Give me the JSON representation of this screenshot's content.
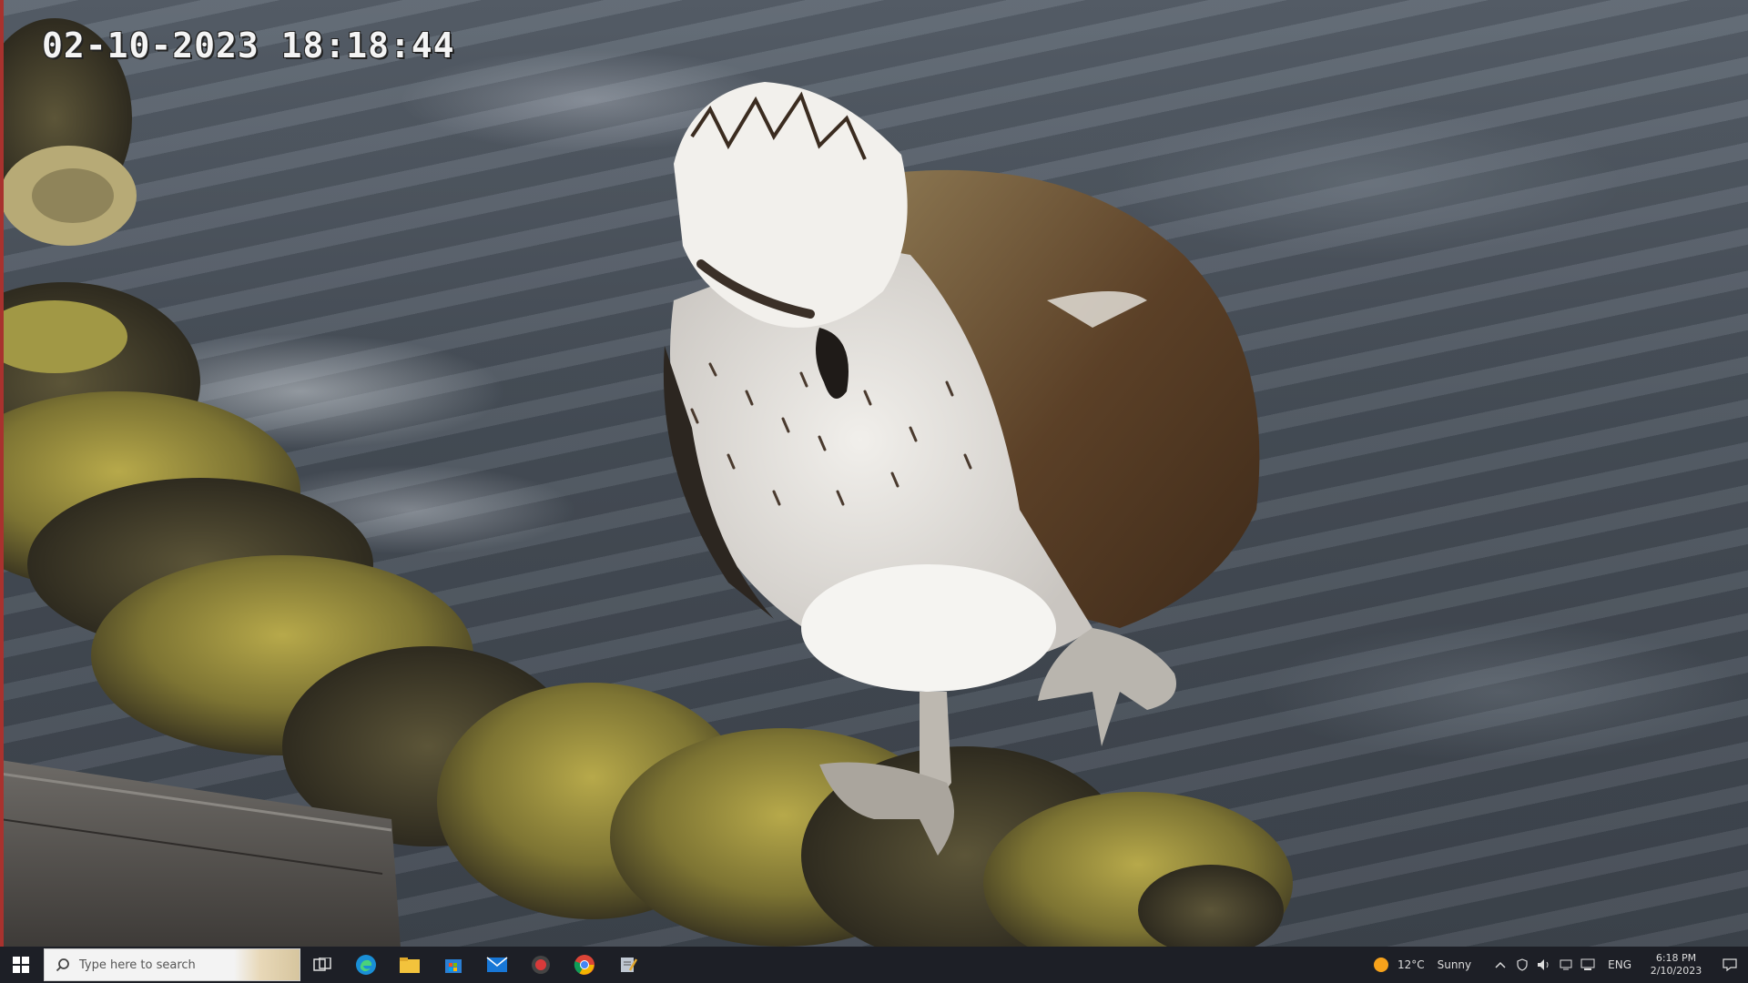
{
  "camera": {
    "timestamp": "02-10-2023 18:18:44"
  },
  "taskbar": {
    "search_placeholder": "Type here to search",
    "pinned_apps": [
      "task-view-icon",
      "edge-icon",
      "file-explorer-icon",
      "microsoft-store-icon",
      "mail-icon",
      "recorder-icon",
      "chrome-icon",
      "notepad-icon"
    ],
    "weather_temp": "12°C",
    "weather_desc": "Sunny",
    "language": "ENG",
    "clock_time": "6:18 PM",
    "clock_date": "2/10/2023"
  },
  "colors": {
    "taskbar_bg": "#1d1f26",
    "water": "#4a525c",
    "rope_moss": "#8f8a3a"
  }
}
